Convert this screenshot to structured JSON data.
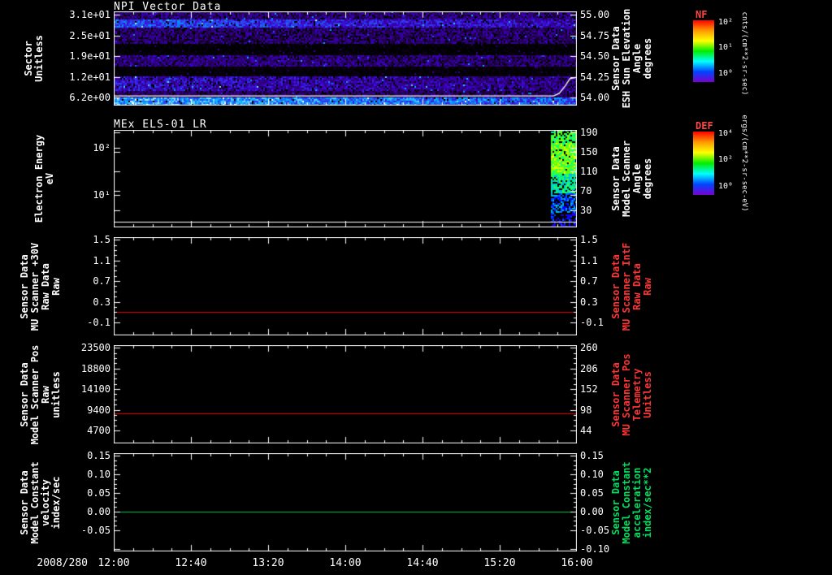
{
  "meta": {
    "background": "#000000",
    "foreground": "#ffffff"
  },
  "x_axis": {
    "date_label": "2008/280",
    "tick_labels": [
      "12:00",
      "12:40",
      "13:20",
      "14:00",
      "14:40",
      "15:20",
      "16:00"
    ]
  },
  "chart_data": [
    {
      "type": "heatmap",
      "title": "NPI Vector Data",
      "ylabel_lines": [
        "Sector",
        "Unitless"
      ],
      "yticks": [
        "3.1e+01",
        "2.5e+01",
        "1.9e+01",
        "1.2e+01",
        "6.2e+00"
      ],
      "ytick_fracs": [
        0.034,
        0.259,
        0.474,
        0.698,
        0.914
      ],
      "right_label_lines": [
        "Sensor Data",
        "ESH Sun Elevation",
        "Angle",
        "degrees"
      ],
      "right_label_color": "#ffffff",
      "right_ticks": [
        "55.00",
        "54.75",
        "54.50",
        "54.25",
        "54.00"
      ],
      "right_tick_fracs": [
        0.034,
        0.259,
        0.474,
        0.698,
        0.914
      ],
      "colorbar": "NF",
      "palette": [
        [
          0,
          "#000000"
        ],
        [
          0.18,
          "#16002c"
        ],
        [
          0.32,
          "#2b0070"
        ],
        [
          0.46,
          "#3c00c8"
        ],
        [
          0.6,
          "#2a48f0"
        ],
        [
          0.74,
          "#00a8ff"
        ],
        [
          0.88,
          "#9fe8ff"
        ],
        [
          1,
          "#ffffff"
        ]
      ],
      "bands": [
        {
          "y0": 0.0,
          "y1": 0.07,
          "base": 0.32,
          "var": 0.3,
          "xgrad": 0.0,
          "black": 0.1
        },
        {
          "y0": 0.07,
          "y1": 0.17,
          "base": 0.42,
          "var": 0.25,
          "xgrad": 0.18,
          "black": 0.05
        },
        {
          "y0": 0.17,
          "y1": 0.34,
          "base": 0.3,
          "var": 0.3,
          "xgrad": 0.0,
          "black": 0.15
        },
        {
          "y0": 0.34,
          "y1": 0.46,
          "base": 0.06,
          "var": 0.12,
          "xgrad": 0.0,
          "black": 0.55
        },
        {
          "y0": 0.46,
          "y1": 0.57,
          "base": 0.3,
          "var": 0.28,
          "xgrad": 0.05,
          "black": 0.1
        },
        {
          "y0": 0.57,
          "y1": 0.68,
          "base": 0.07,
          "var": 0.12,
          "xgrad": 0.0,
          "black": 0.5
        },
        {
          "y0": 0.68,
          "y1": 0.84,
          "base": 0.34,
          "var": 0.28,
          "xgrad": 0.12,
          "black": 0.08
        },
        {
          "y0": 0.84,
          "y1": 0.9,
          "base": 0.28,
          "var": 0.25,
          "xgrad": 0.0,
          "black": 0.1
        },
        {
          "y0": 0.9,
          "y1": 1.0,
          "base": 0.6,
          "var": 0.3,
          "xgrad": 0.15,
          "black": 0.03
        }
      ],
      "trace": {
        "color": "#ffffff",
        "points": [
          [
            0,
            0.897
          ],
          [
            0.95,
            0.897
          ],
          [
            0.962,
            0.87
          ],
          [
            0.975,
            0.79
          ],
          [
            0.985,
            0.715
          ],
          [
            1,
            0.7
          ]
        ]
      }
    },
    {
      "type": "heatmap",
      "title": "MEx ELS-01 LR",
      "ylabel_lines": [
        "Electron Energy",
        "eV"
      ],
      "yticks": [
        "10²",
        "10¹"
      ],
      "ytick_fracs": [
        0.183,
        0.667
      ],
      "right_label_lines": [
        "Sensor Data",
        "Model Scanner",
        "Angle",
        "degrees"
      ],
      "right_label_color": "#ffffff",
      "right_ticks": [
        "190",
        "150",
        "110",
        "70",
        "30"
      ],
      "right_tick_fracs": [
        0.025,
        0.225,
        0.425,
        0.625,
        0.825
      ],
      "colorbar": "DEF",
      "palette": [
        [
          0,
          "#4400aa"
        ],
        [
          0.2,
          "#0000ff"
        ],
        [
          0.35,
          "#00aaff"
        ],
        [
          0.5,
          "#00ff88"
        ],
        [
          0.65,
          "#66ff00"
        ],
        [
          0.8,
          "#ffff00"
        ],
        [
          0.9,
          "#ff8800"
        ],
        [
          1,
          "#ff0000"
        ]
      ],
      "burst": {
        "x0": 0.945,
        "x1": 1.0,
        "bands": [
          {
            "y0": 0.0,
            "y1": 0.12,
            "vmin": 0.45,
            "vmax": 0.7,
            "fill": 0.7
          },
          {
            "y0": 0.12,
            "y1": 0.45,
            "vmin": 0.5,
            "vmax": 0.8,
            "fill": 0.95
          },
          {
            "y0": 0.45,
            "y1": 0.65,
            "vmin": 0.35,
            "vmax": 0.6,
            "fill": 0.85
          },
          {
            "y0": 0.65,
            "y1": 0.85,
            "vmin": 0.15,
            "vmax": 0.4,
            "fill": 0.6
          },
          {
            "y0": 0.85,
            "y1": 1.0,
            "vmin": 0.05,
            "vmax": 0.3,
            "fill": 0.5
          }
        ]
      },
      "hline": {
        "yfrac": 0.942,
        "color": "#ffffff"
      }
    },
    {
      "type": "line",
      "ylabel_lines": [
        "Sensor Data",
        "MU Scanner +30V",
        "Raw Data",
        "Raw"
      ],
      "yticks": [
        "1.5",
        "1.1",
        "0.7",
        "0.3",
        "-0.1"
      ],
      "ytick_values": [
        1.5,
        1.1,
        0.7,
        0.3,
        -0.1
      ],
      "ytick_fracs": [
        0.026,
        0.237,
        0.447,
        0.658,
        0.868
      ],
      "ylim": [
        -0.35,
        1.55
      ],
      "right_label_lines": [
        "Sensor Data",
        "MU Scanner IntF",
        "Raw Data",
        "Raw"
      ],
      "right_label_color": "#ff3535",
      "right_ticks": [
        "1.5",
        "1.1",
        "0.7",
        "0.3",
        "-0.1"
      ],
      "right_tick_fracs": [
        0.026,
        0.237,
        0.447,
        0.658,
        0.868
      ],
      "series": [
        {
          "name": "MU Scanner +30V Raw Data",
          "color": "#e80000",
          "value": 0.1
        }
      ]
    },
    {
      "type": "line",
      "ylabel_lines": [
        "Sensor Data",
        "Model Scanner Pos",
        "Raw",
        "unitless"
      ],
      "yticks": [
        "23500",
        "18800",
        "14100",
        "9400",
        "4700"
      ],
      "ytick_values": [
        23500,
        18800,
        14100,
        9400,
        4700
      ],
      "ytick_fracs": [
        0.026,
        0.237,
        0.447,
        0.658,
        0.868
      ],
      "ylim": [
        2100,
        24100
      ],
      "right_label_lines": [
        "Sensor Data",
        "MU Scanner Pos",
        "Telemetry",
        "Unitless"
      ],
      "right_label_color": "#ff3535",
      "right_ticks": [
        "260",
        "206",
        "152",
        "98",
        "44"
      ],
      "right_tick_fracs": [
        0.026,
        0.237,
        0.447,
        0.658,
        0.868
      ],
      "series": [
        {
          "name": "Model Scanner Pos Raw",
          "color": "#e80000",
          "value": 8800
        }
      ]
    },
    {
      "type": "line",
      "ylabel_lines": [
        "Sensor Data",
        "Model Constant",
        "velocity",
        "index/sec"
      ],
      "yticks": [
        "0.15",
        "0.10",
        "0.05",
        "0.00",
        "-0.05"
      ],
      "ytick_values": [
        0.15,
        0.1,
        0.05,
        0.0,
        -0.05
      ],
      "ytick_fracs": [
        0.0265,
        0.216,
        0.405,
        0.594,
        0.784
      ],
      "ylim": [
        -0.107,
        0.157
      ],
      "right_label_lines": [
        "Sensor Data",
        "Model Constant",
        "acceleration",
        "index/sec**2"
      ],
      "right_label_color": "#00e060",
      "right_ticks": [
        "0.15",
        "0.10",
        "0.05",
        "0.00",
        "-0.05",
        "-0.10"
      ],
      "right_tick_fracs": [
        0.0265,
        0.216,
        0.405,
        0.594,
        0.784,
        0.9735
      ],
      "series": [
        {
          "name": "Model Constant velocity",
          "color": "#00c050",
          "value": 0.0
        }
      ]
    }
  ],
  "colorbars": [
    {
      "name": "NF",
      "name_color": "#ff4444",
      "unit": "cnts/(cm**2-sr-sec)",
      "ticks": [
        "10²",
        "10¹",
        "10⁰"
      ],
      "colors": [
        "#ff0000",
        "#ff9900",
        "#ffff00",
        "#00ee00",
        "#00ffff",
        "#0044ff",
        "#7a00d0"
      ]
    },
    {
      "name": "DEF",
      "name_color": "#ff4444",
      "unit": "ergs/(cm**2-sr-sec-eV)",
      "ticks": [
        "10⁴",
        "10²",
        "10⁰"
      ],
      "colors": [
        "#ff0000",
        "#ff9900",
        "#ffff00",
        "#00ee00",
        "#00ffff",
        "#0044ff",
        "#7a00d0"
      ]
    }
  ]
}
